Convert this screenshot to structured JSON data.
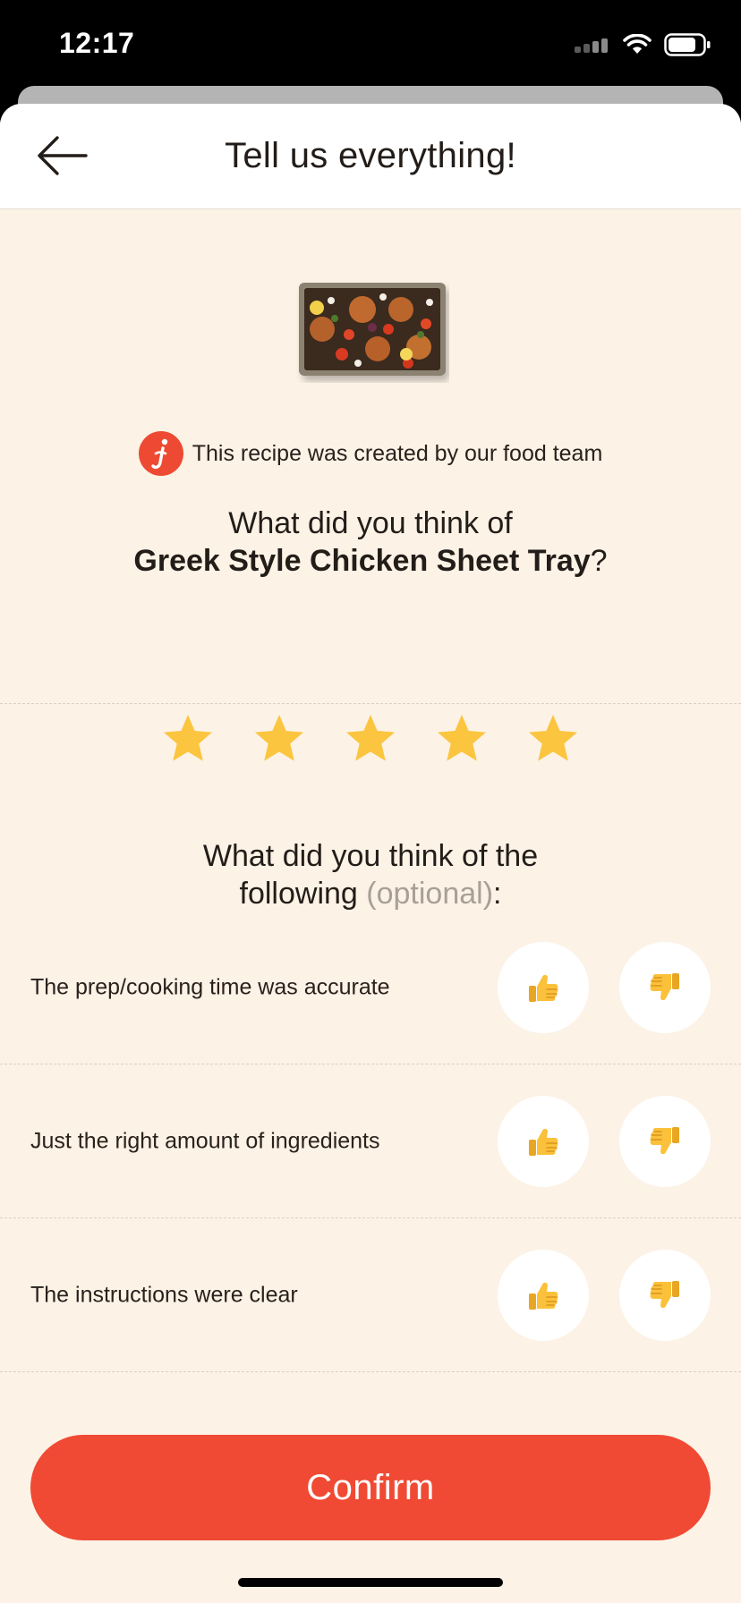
{
  "status_bar": {
    "time": "12:17"
  },
  "header": {
    "title": "Tell us everything!",
    "back_icon": "arrow-left-icon"
  },
  "recipe": {
    "creator_text": "This recipe was created by our food team",
    "brand_badge_letter": "j",
    "brand_color": "#ee4a33"
  },
  "rating": {
    "question_prefix": "What did you think of",
    "dish_name": "Greek Style Chicken Sheet Tray",
    "question_suffix": "?",
    "stars_total": 5,
    "stars_filled": 5,
    "star_color": "#fbc53f"
  },
  "feedback": {
    "question_line1": "What did you think of the",
    "question_line2": "following ",
    "optional_label": "(optional)",
    "question_end": ":",
    "items": [
      {
        "label": "The prep/cooking time was accurate",
        "up_icon": "thumbs-up-icon",
        "down_icon": "thumbs-down-icon"
      },
      {
        "label": "Just the right amount of ingredients",
        "up_icon": "thumbs-up-icon",
        "down_icon": "thumbs-down-icon"
      },
      {
        "label": "The instructions were clear",
        "up_icon": "thumbs-up-icon",
        "down_icon": "thumbs-down-icon"
      }
    ]
  },
  "confirm": {
    "label": "Confirm",
    "color": "#f04a34"
  }
}
